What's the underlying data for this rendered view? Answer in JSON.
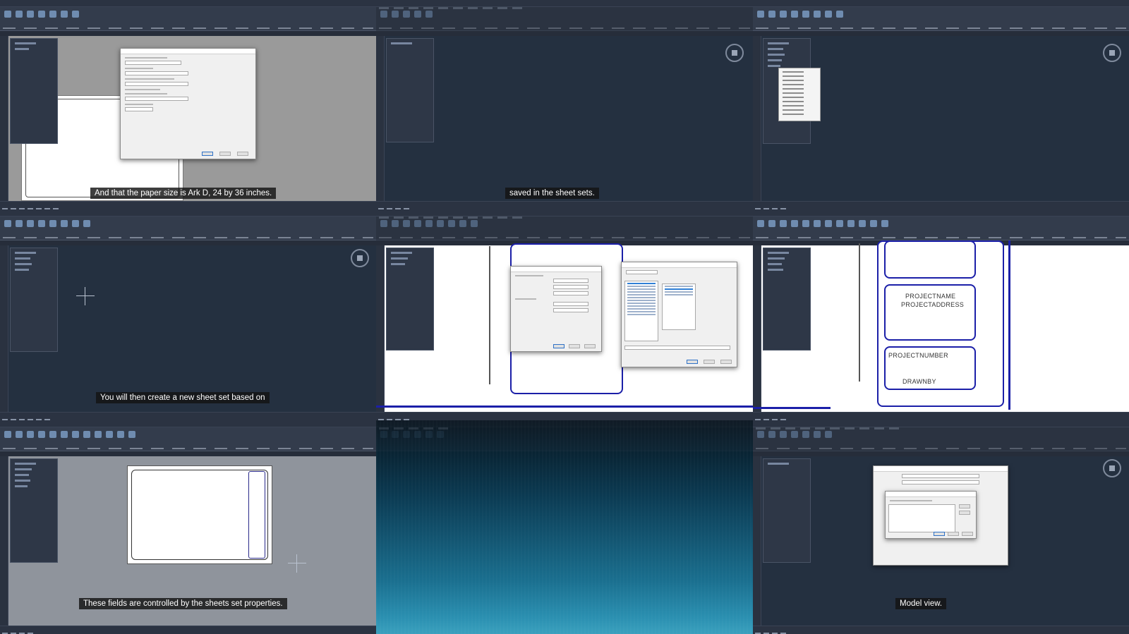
{
  "panels": {
    "p1": {
      "caption": "And that the paper size is Ark D, 24 by 36 inches."
    },
    "p2": {
      "caption": "saved in the sheet sets."
    },
    "p3": {
      "caption": ""
    },
    "p4": {
      "caption": "You will then create a new sheet set based on"
    },
    "p5": {
      "caption": ""
    },
    "p6": {
      "caption": "",
      "titleblock": {
        "project_name": "PROJECTNAME",
        "project_address": "PROJECTADDRESS",
        "project_number": "PROJECTNUMBER",
        "drawn_by": "DRAWNBY"
      }
    },
    "p7": {
      "caption": "These fields are controlled by the sheets set properties."
    },
    "p8": {
      "caption": ""
    },
    "p9": {
      "caption": "Model view."
    }
  },
  "colors": {
    "ui_dark": "#1f2632",
    "ribbon": "#333c4c",
    "titleblock_blue": "#1b1fa8",
    "caption_bg": "#141414"
  }
}
